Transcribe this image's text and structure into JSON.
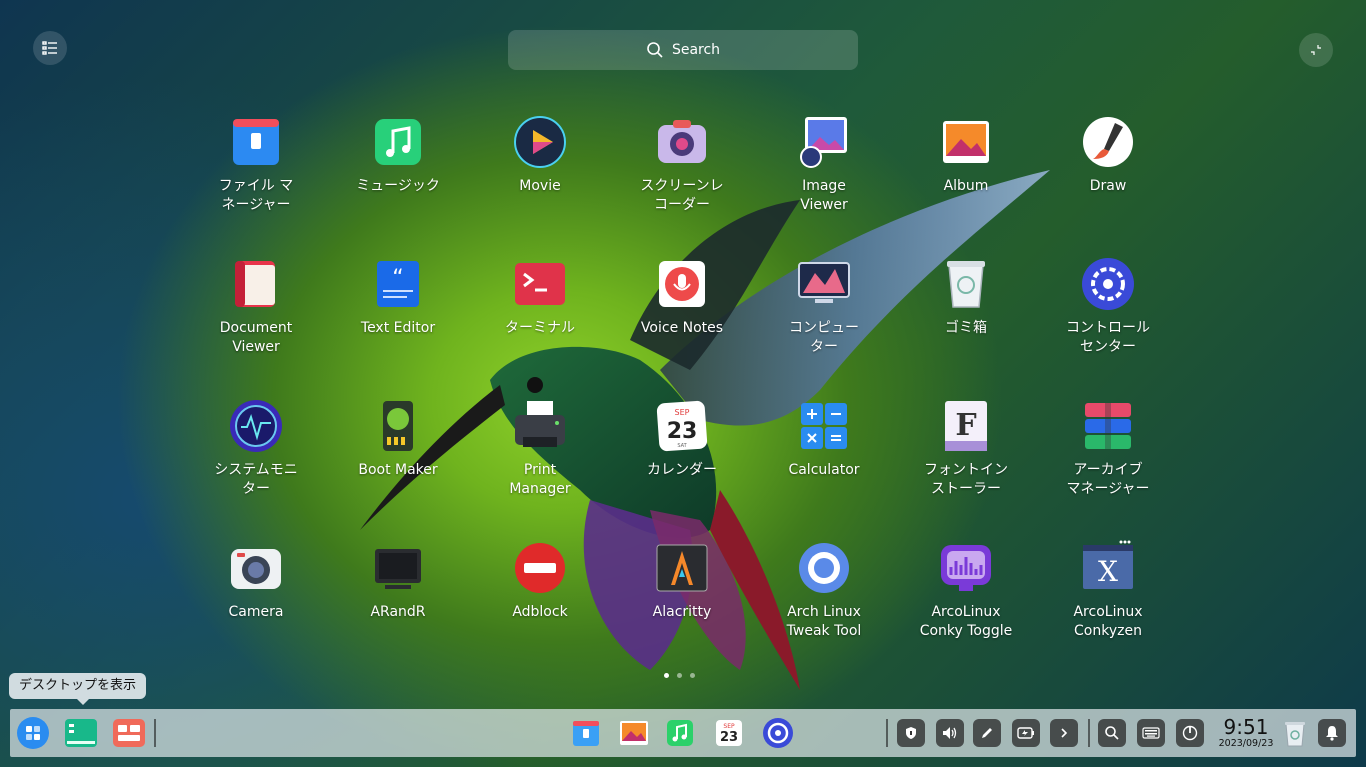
{
  "top": {
    "search_label": "Search"
  },
  "apps": [
    {
      "label": "ファイル マ\nネージャー",
      "icon": "file-manager-icon"
    },
    {
      "label": "ミュージック",
      "icon": "music-icon"
    },
    {
      "label": "Movie",
      "icon": "movie-icon"
    },
    {
      "label": "スクリーンレ\nコーダー",
      "icon": "screen-recorder-icon"
    },
    {
      "label": "Image\nViewer",
      "icon": "image-viewer-icon"
    },
    {
      "label": "Album",
      "icon": "album-icon"
    },
    {
      "label": "Draw",
      "icon": "draw-icon"
    },
    {
      "label": "Document\nViewer",
      "icon": "document-viewer-icon"
    },
    {
      "label": "Text Editor",
      "icon": "text-editor-icon"
    },
    {
      "label": "ターミナル",
      "icon": "terminal-icon"
    },
    {
      "label": "Voice Notes",
      "icon": "voice-notes-icon"
    },
    {
      "label": "コンピュー\nター",
      "icon": "computer-icon"
    },
    {
      "label": "ゴミ箱",
      "icon": "trash-icon"
    },
    {
      "label": "コントロール\nセンター",
      "icon": "control-center-icon"
    },
    {
      "label": "システムモニ\nター",
      "icon": "system-monitor-icon"
    },
    {
      "label": "Boot Maker",
      "icon": "boot-maker-icon"
    },
    {
      "label": "Print\nManager",
      "icon": "print-manager-icon"
    },
    {
      "label": "カレンダー",
      "icon": "calendar-icon"
    },
    {
      "label": "Calculator",
      "icon": "calculator-icon"
    },
    {
      "label": "フォントイン\nストーラー",
      "icon": "font-installer-icon"
    },
    {
      "label": "アーカイブ\nマネージャー",
      "icon": "archive-manager-icon"
    },
    {
      "label": "Camera",
      "icon": "camera-icon"
    },
    {
      "label": "ARandR",
      "icon": "arandr-icon"
    },
    {
      "label": "Adblock",
      "icon": "adblock-icon"
    },
    {
      "label": "Alacritty",
      "icon": "alacritty-icon"
    },
    {
      "label": "Arch Linux\nTweak Tool",
      "icon": "arch-tweak-tool-icon"
    },
    {
      "label": "ArcoLinux\nConky Toggle",
      "icon": "conky-toggle-icon"
    },
    {
      "label": "ArcoLinux\nConkyzen",
      "icon": "conkyzen-icon"
    }
  ],
  "calendar_icon": {
    "month": "SEP",
    "day": "23",
    "weekday": "SAT"
  },
  "pager": {
    "pages": 3,
    "current": 1
  },
  "tooltip": "デスクトップを表示",
  "taskbar": {
    "clock_time": "9:51",
    "clock_date": "2023/09/23"
  },
  "colors": {
    "accent": "#2a8cf0",
    "dock": "#dce4e8"
  }
}
